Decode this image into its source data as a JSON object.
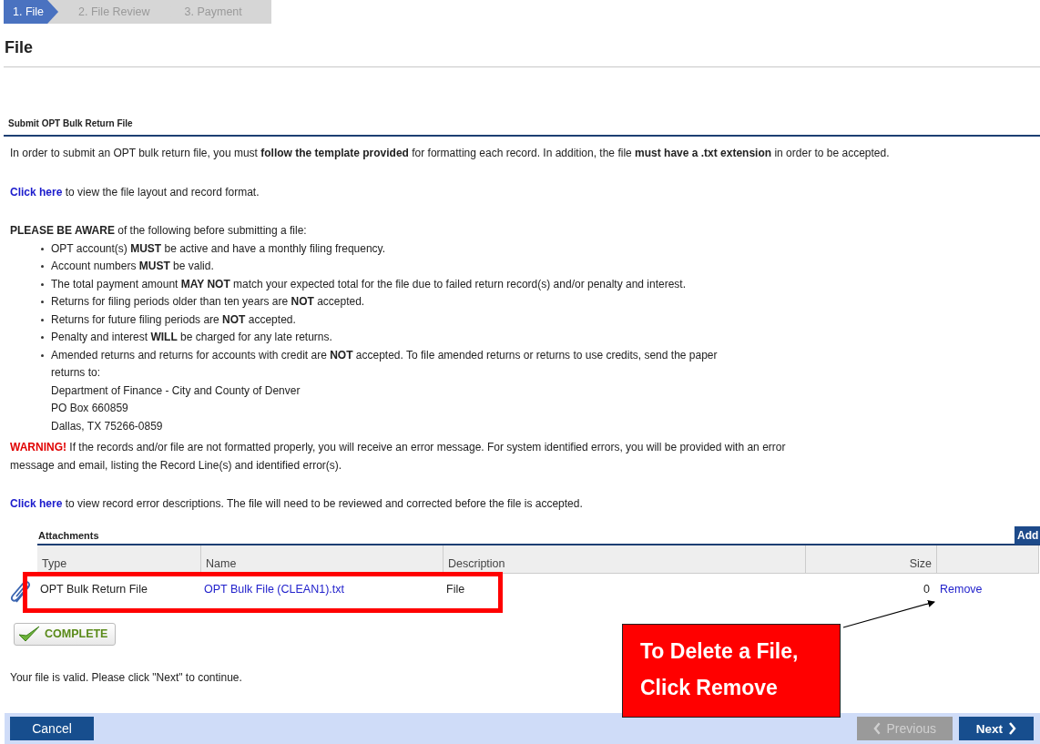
{
  "steps": [
    {
      "label": "1. File",
      "selected": true
    },
    {
      "label": "2. File Review",
      "selected": false
    },
    {
      "label": "3. Payment",
      "selected": false
    }
  ],
  "page_title": "File",
  "section_title": "Submit OPT Bulk Return File",
  "intro": "In order to submit an OPT bulk return file, you must **follow the template provided** for formatting each record. In addition, the file **must have a .txt extension** in order to be accepted.",
  "layout_link": {
    "link": "Click here",
    "text": "to view the file layout and record format."
  },
  "aware_heading": "**PLEASE BE AWARE** of the following before submitting a file:",
  "aware_items": [
    {
      "text": "OPT account(s) **MUST** be active and have a monthly filing frequency."
    },
    {
      "text": "Account numbers **MUST** be valid."
    },
    {
      "text": "The total payment amount **MAY NOT** match your expected total for the file due to failed return record(s) and/or penalty and interest."
    },
    {
      "text": "Returns for filing periods older than ten years are **NOT** accepted."
    },
    {
      "text": "Returns for future filing periods are **NOT** accepted."
    },
    {
      "text": "Penalty and interest **WILL** be charged for any late returns."
    },
    {
      "text": "Amended returns and returns for accounts with credit are **NOT** accepted. To file amended returns or returns to use credits, send the paper returns to:",
      "address": [
        "Department of Finance - City and County of Denver",
        "PO Box 660859",
        "Dallas, TX 75266-0859"
      ]
    }
  ],
  "warning": {
    "label": "WARNING!",
    "text": "If the records and/or file are not formatted properly, you will receive an error message. For system identified errors, you will be provided with an error message and email, listing the Record Line(s) and identified error(s)."
  },
  "errors_link": {
    "link": "Click here",
    "text": "to view record error descriptions. The file will need to be reviewed and corrected before the file is accepted."
  },
  "attachments": {
    "title": "Attachments",
    "add_button": "Add",
    "columns": [
      "Type",
      "Name",
      "Description",
      "Size"
    ],
    "rows": [
      {
        "type": "OPT Bulk Return File",
        "name": "OPT Bulk File (CLEAN1).txt",
        "description": "File",
        "size": "0",
        "action": "Remove"
      }
    ]
  },
  "status_badge": "COMPLETE",
  "status_message": "Your file is valid. Please click \"Next\" to continue.",
  "footer": {
    "cancel": "Cancel",
    "previous": {
      "label": "Previous",
      "disabled": true
    },
    "next": {
      "label": "Next",
      "disabled": false
    }
  },
  "callout": {
    "lines": [
      "To Delete a File,",
      "Click Remove"
    ]
  }
}
